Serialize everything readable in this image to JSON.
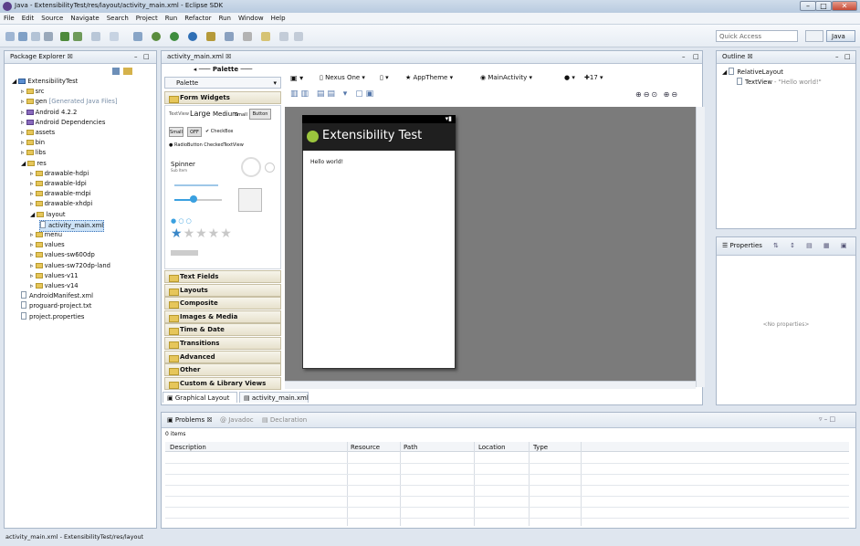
{
  "window": {
    "title": "Java - ExtensibilityTest/res/layout/activity_main.xml - Eclipse SDK",
    "min": "–",
    "max": "□",
    "close": "✕"
  },
  "menu": [
    "File",
    "Edit",
    "Source",
    "Navigate",
    "Search",
    "Project",
    "Run",
    "Refactor",
    "Run",
    "Window",
    "Help"
  ],
  "quick_access": "Quick Access",
  "perspective": "Java",
  "package_explorer": {
    "tab": "Package Explorer ☒",
    "items": [
      {
        "label": "ExtensibilityTest",
        "level": 0
      },
      {
        "label": "src",
        "level": 1
      },
      {
        "label": "gen",
        "note": "[Generated Java Files]",
        "level": 1
      },
      {
        "label": "Android 4.2.2",
        "level": 1
      },
      {
        "label": "Android Dependencies",
        "level": 1
      },
      {
        "label": "assets",
        "level": 1
      },
      {
        "label": "bin",
        "level": 1
      },
      {
        "label": "libs",
        "level": 1
      },
      {
        "label": "res",
        "level": 1
      },
      {
        "label": "drawable-hdpi",
        "level": 2
      },
      {
        "label": "drawable-ldpi",
        "level": 2
      },
      {
        "label": "drawable-mdpi",
        "level": 2
      },
      {
        "label": "drawable-xhdpi",
        "level": 2
      },
      {
        "label": "layout",
        "level": 2
      },
      {
        "label": "activity_main.xml",
        "level": 3
      },
      {
        "label": "menu",
        "level": 2
      },
      {
        "label": "values",
        "level": 2
      },
      {
        "label": "values-sw600dp",
        "level": 2
      },
      {
        "label": "values-sw720dp-land",
        "level": 2
      },
      {
        "label": "values-v11",
        "level": 2
      },
      {
        "label": "values-v14",
        "level": 2
      },
      {
        "label": "AndroidManifest.xml",
        "level": 1
      },
      {
        "label": "proguard-project.txt",
        "level": 1
      },
      {
        "label": "project.properties",
        "level": 1
      }
    ]
  },
  "editor": {
    "tab": "activity_main.xml ☒",
    "palette_header": "Palette",
    "palette_dropdown": "Palette",
    "form_widgets": "Form Widgets",
    "widgets": {
      "textview": "TextView",
      "large": "Large",
      "medium": "Medium",
      "small": "Small",
      "button": "Button",
      "small_btn": "Small",
      "off": "OFF",
      "checkbox": "CheckBox",
      "radio": "RadioButton",
      "checked_tv": "CheckedTextView",
      "spinner": "Spinner",
      "spinner_sub": "Sub Item"
    },
    "categories": [
      "Text Fields",
      "Layouts",
      "Composite",
      "Images & Media",
      "Time & Date",
      "Transitions",
      "Advanced",
      "Other",
      "Custom & Library Views"
    ],
    "device": "Nexus One",
    "theme": "AppTheme",
    "activity": "MainActivity",
    "api": "17",
    "app_title": "Extensibility Test",
    "hello": "Hello world!",
    "bottom_tabs": [
      "Graphical Layout",
      "activity_main.xml"
    ]
  },
  "outline": {
    "tab": "Outline ☒",
    "root": "RelativeLayout",
    "child": "TextView",
    "child_note": " - \"Hello world!\""
  },
  "properties": {
    "tab": "Properties",
    "empty": "<No properties>"
  },
  "problems": {
    "tabs": [
      "Problems ☒",
      "Javadoc",
      "Declaration"
    ],
    "count": "0 items",
    "columns": [
      "Description",
      "Resource",
      "Path",
      "Location",
      "Type"
    ]
  },
  "status": "activity_main.xml - ExtensibilityTest/res/layout"
}
